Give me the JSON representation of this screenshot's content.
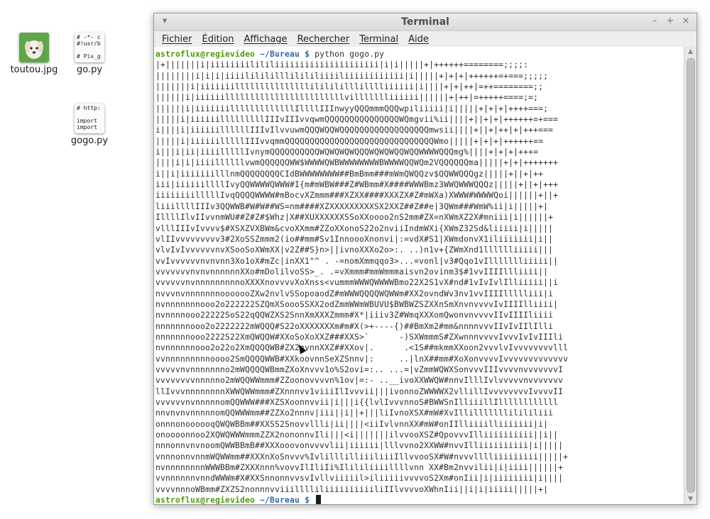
{
  "desktop": {
    "icons": [
      {
        "label": "toutou.jpg"
      },
      {
        "label": "go.py",
        "preview": "# -*- c\n#!usr/b\n\n# Pix_g"
      },
      {
        "label": "gogo.py",
        "preview": "# http:\n\nimport\nimport"
      }
    ]
  },
  "terminal": {
    "title": "Terminal",
    "menu": [
      "Fichier",
      "Édition",
      "Affichage",
      "Rechercher",
      "Terminal",
      "Aide"
    ],
    "prompt_user": "astroflux@regievideo",
    "prompt_path": "~/Bureau",
    "prompt_symbol": "$",
    "command": "python gogo.py",
    "output_lines": [
      "|+|||||||i|iiiiiiiilililiiiiiiiiiiiiiiiiiiiii|i|i|||||+|++++++========;;;;:",
      "||||||||i|i|i|iiiililililllilililiiiiliiiiiiiiiiii|i|||||+|+|+|++++++=+===;;;;;",
      "|||||||i|iiiiiiilllllllllllllllililililllilllliiiiii|i||||+|+|++|=++========;;",
      "||||||i|iiiiiillllllllllllllllllllllllvillllllliiiiii||||||+|++|=+++++====;=;",
      "||||||i|iiiiiiilllllllllllllIllllIIInwyyQQQmmmQQQwpiliiiii|i|||||+|+|+|++++===;",
      "|||||i|iiiiiilllllllllIIIvIIIvvqwmQQQQQQQQQQQQQQQWQmgvii%ii||||+||+|+|++++++=+===",
      "i||||i|iiiiiillllllIIIvIlvvuwmQQQWQQWQQQQQQQQQQQQQQQQQQmwsii||||+||+|++|+|+++===",
      "|||||i|iiiiiilllllIIIvvqmmQQQQQQQQQQQQQQQQQQQQQQQQQQQQQQWmo|||||+|+|+|++++++==",
      "i|||i|ii|iiiilllllIvnymQQQQQQQQQQWQWQWQWQQQWQWQWQQWQQWWWWQQQmg%||||+|+|+|+++=",
      "||||i|i|iiiillllllvwmQQQQQQWW$WWWWQWBWWWWWWWWBWWWWQQWQm2VQQQQQQma|||||+|+|+++++++",
      "i||i|iiiiiiilllnmQQQQQQQQCIdBWWWWWWWW##BmBmm###mWmQWQQzv$QQWWQQQgz|||||+||+|++",
      "iii|iiiiiillllIvyQQWWWWQWWW#I{m#mWBW###Z#WBmm#X####WWWBmz3WWQWWWQQQz|||||+||+|+++",
      "iiiiiiiilllllIvqQQQQWWWW#mBocvXZmmm###XZXX####XXXZX#Z#mWXa)XWWW#WWWWQoi||||||+||+",
      "liiillllIIIv3QQWWB#W#W##WS=nm####XZXXXXXXXXXSX2XXZ##Z##e|3QWm###WmW%ii|i|||||+|",
      "IllllIlvIIvvnmWU##Z#Z#$Whz|X##XUXXXXXXSSoXXoooo2nS2mm#ZX=nXWmXZ2X#mniii|i||||||+",
      "vlllIIIvIvvvv$#XSXZVXBWm&cvoXXmm#ZZoXXonoS22o2nviiIndmWXi{XWmZ32Sd&liiiii|i|||||",
      "vlIIvvvvvvvvv3#2XoSSZmmm2(io##mm#Sv1InnoooXnonvi|:=vdX#S1|XWmdonvX1iliiiiiii|i||",
      "vlvIvIvvvvvvnvXSooSoXWmXX|v2Z##S}n>||ivnoXXXo2o>:. ..)n1v+{ZWmXnd1lllllliiiii|||",
      "vvIvvvvvvnvnvnn3Xo1oX#mZc|inXX1\"^ . -=nomXmmqqo3>...=vonl|v3#Qqo1vIllllllliiiii||",
      "vvvvvvvnvnvnnnnnnXXo#mDolilvoSS>_. .=vXmmm#mmWmmmaisvn2ovinm3$#1vvIIIIllliiii||",
      "vvvvvvnvnnnnnnnnnoXXXXnovvvvXoXnss<vummmWWWQWWWWBmo22X2S1vX#nd#1vIvIvlIlliiiii||i",
      "nvvvnvnnnnnnnooooooZXw2nvlvSSopoaodZ#mWWWQQQQWQWWm#XX2ovndWv3nv1vvIIIIllllliii|i",
      "nvnnnnnnnooo2o222222SZQmXSoooSSXX2odZmmWWmWBUVU$BWBWZSZXXnSmXnvnvvvvIvIIIIlliiii|",
      "nvnnnnooo22222SoS22qQQWZXS2SnnXmXXXZmmm#X*|iiiv3Z#WmqXXXomQwonvnvvvvIIvIIIIliiii",
      "nnnnnnnooo2o2222222mWQQQ#S22oXXXXXXXm#m#X(>+----{)##BmXm2#mm&nnnnvvvIIvIvIIlIlli",
      "nnnnnnnooo2222S22XmQWQQW#XXoSoXoXXZ###XXS>`      -)SXWmmmS#ZXwnnnvvvvIvvvIvIvIIIli",
      "nvnnnnnnooo2o22o2XmQQQQWB#ZX2nvnnXXZ##XXov|.      .<1S##mkmmXXoon2vvvlvIvvvvvvvvlll",
      "vvnnnnnnnnnoooo2SmQQQQWWB#XXkoovnnSeXZSnnv|:     ..|lnX##mm#XoXonvvvvIvvvvvvvvvvvvv",
      "vvvvvnvnnnnnnno2mWQQQQWBmmZXoXnvvv1o%S2ovi=:.. ...=|vZmmWQWXSonvvvIIIvvvvnvvvvvvvI",
      "vvvvvvvvnnnnno2mWQQWWmmm#ZZoonovvvvn%1ov|=:- ..__ivoXXWWQW#nnvIlllIvlvvvvvnvvvvvvv",
      "llIvvvnnnnnnnnXWWQWWmmm#ZXnnnvv1viiiIlIvvvii|||ivonnoZWWWWX2vllillIvvvvvvvvIvvvvII",
      "vvvvvvnvnnnnnomQQWWW###XZSXoonnvvii|i|||i{{lvlIvvvnnoS#BWWSnIlliiillIllllllllllll",
      "nnvnvnvnnnnnomQQWWWmm##ZZXo2nnnv|iii||i||+|||liIvnoXSX#mW#XvIllilllllllilililiii",
      "onnnonoooooqQWQWBBm##XXSS2Snovvllli|ii||||<iiIvlvnnXX#mW#onIIlliiiilliiiiiii|i|",
      "onoooonnoo2XQWQWWWmmmZZX2nononnvIli|||<i|||||||ilvvooXSZ#QpovvvIlliiiiiiiiii||i||",
      "nnnonnvnvnoomQWWBBmB##XXXooovonvvvvlii|iiiiii|lllvvno2XXWW#nvvIlliiiiiiiiii|i|||||",
      "vnnnonnvnnmWQWWmm##XXXnXoSnvvv%IvlilllilliiiliiiIllvvooSX#W#nvvvlllliiiiiiiii|||||+",
      "nvnnnnnnnnWWWBBm#ZXXXnnn%vovvIlIliIi%Ilililiiiillllvnn XX#Bm2nvvilii|i|iiii||||||+",
      "vvnnnnnnvnndWWWm#X#XXSnnonnvvsvIvllviiiiil>iliiiiivvvvoS2Xm#onIii|i|iiiiiiii|i||||",
      "vvvvnnnoWBmm#ZXZS2nonnnvviiilllliliiiiiiiiiiliIIlvvvvoXWhnIii||i|i|iiiii|||||+|"
    ]
  },
  "colors": {
    "prompt_user": "#4e9a06",
    "prompt_path": "#3465a4",
    "text": "#2e2e2e",
    "background": "#ffffff"
  }
}
